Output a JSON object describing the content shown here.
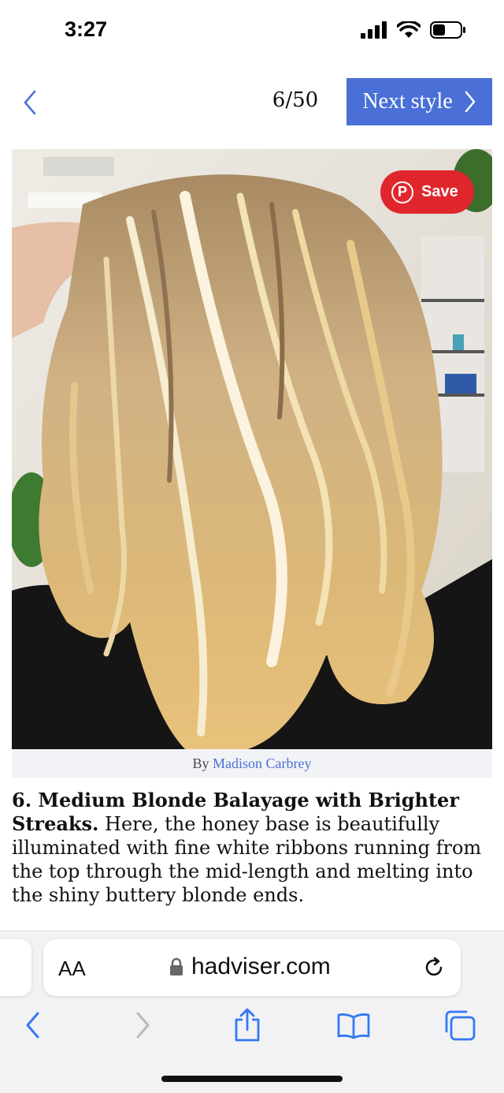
{
  "status_bar": {
    "time": "3:27"
  },
  "nav": {
    "counter": "6/50",
    "next_label": "Next style"
  },
  "photo": {
    "save_label": "Save",
    "pin_letter": "P"
  },
  "credit": {
    "prefix": "By",
    "author": "Madison Carbrey"
  },
  "article": {
    "heading": "6. Medium Blonde Balayage with Brighter Streaks.",
    "body": "Here, the honey base is beautifully illuminated with fine white ribbons running from the top through the mid-length and melting into the shiny buttery blonde ends."
  },
  "browser": {
    "aa_label": "AA",
    "url": "hadviser.com",
    "icons": [
      "lock-icon",
      "reload-icon",
      "back-icon",
      "forward-icon",
      "share-icon",
      "bookmarks-icon",
      "tabs-icon"
    ]
  },
  "colors": {
    "accent": "#4a6fd6",
    "pinterest": "#e0262d"
  }
}
